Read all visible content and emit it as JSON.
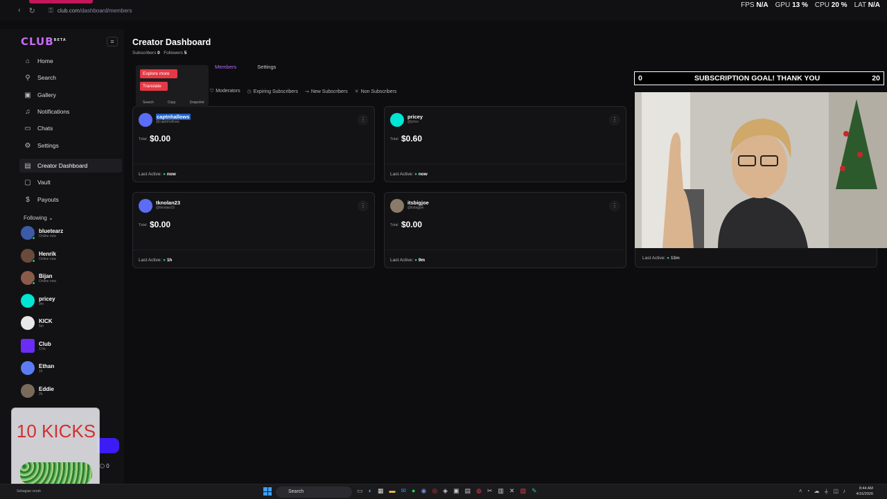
{
  "browser": {
    "url_host": "club.com",
    "url_path": "/dashboard/members"
  },
  "stats": {
    "fps_label": "FPS",
    "fps": "N/A",
    "gpu_label": "GPU",
    "gpu": "13 %",
    "cpu_label": "CPU",
    "cpu": "20 %",
    "lat_label": "LAT",
    "lat": "N/A"
  },
  "sidebar": {
    "logo": "CLUB",
    "logo_badge": "BETA",
    "items": [
      {
        "label": "Home",
        "icon": "home-icon"
      },
      {
        "label": "Search",
        "icon": "search-icon"
      },
      {
        "label": "Gallery",
        "icon": "gallery-icon"
      },
      {
        "label": "Notifications",
        "icon": "bell-icon"
      },
      {
        "label": "Chats",
        "icon": "chat-icon"
      },
      {
        "label": "Settings",
        "icon": "gear-icon"
      },
      {
        "label": "Creator Dashboard",
        "icon": "dashboard-icon",
        "active": true
      },
      {
        "label": "Vault",
        "icon": "vault-icon"
      },
      {
        "label": "Payouts",
        "icon": "dollar-icon"
      }
    ],
    "following_header": "Following",
    "following": [
      {
        "name": "bluetearz",
        "status": "Online now",
        "color": "#3b5ba8"
      },
      {
        "name": "Henrik",
        "status": "Online now",
        "color": "#6a4a3a"
      },
      {
        "name": "Bijan",
        "status": "Online now",
        "color": "#8a5a4a"
      },
      {
        "name": "pricey",
        "status": "9m",
        "color": "#00e5d4"
      },
      {
        "name": "KICK",
        "status": "5m",
        "color": "#e8e8e8"
      },
      {
        "name": "Club",
        "status": "17m",
        "color": "#6b2cf5"
      },
      {
        "name": "Ethan",
        "status": "1h",
        "color": "#5b7cf5"
      },
      {
        "name": "Eddie",
        "status": "2h",
        "color": "#7a6a5a"
      }
    ]
  },
  "overlay": {
    "kicks": "10 KICKS",
    "badge": "0"
  },
  "main": {
    "title": "Creator Dashboard",
    "subscribers_label": "Subscribers",
    "subscribers": "0",
    "followers_label": "Followers",
    "followers": "5",
    "tabs": [
      {
        "label": "Members",
        "active": true
      },
      {
        "label": "Settings"
      }
    ],
    "filters": [
      "Moderators",
      "Expiring Subscribers",
      "New Subscribers",
      "Non Subscribers"
    ],
    "context_menu": {
      "explore": "Explore more",
      "translate": "Translate",
      "search": "Search",
      "copy": "Copy",
      "snapshot": "Snapshot"
    },
    "members": [
      {
        "name": "captnhallows",
        "handle": "@captnhallows",
        "total_label": "Total",
        "total": "$0.00",
        "last_active_label": "Last Active:",
        "last_active": "now",
        "color": "#5b6cf5"
      },
      {
        "name": "pricey",
        "handle": "@price",
        "total_label": "Total",
        "total": "$0.60",
        "last_active_label": "Last Active:",
        "last_active": "now",
        "color": "#00e5d4"
      },
      {
        "name": "tknolan23",
        "handle": "@tknolan23",
        "total_label": "Total",
        "total": "$0.00",
        "last_active_label": "Last Active:",
        "last_active": "1h",
        "color": "#5b6cf5"
      },
      {
        "name": "itsbigjoe",
        "handle": "@itsbigjoe",
        "total_label": "Total",
        "total": "$0.00",
        "last_active_label": "Last Active:",
        "last_active": "9m",
        "color": "#8a7a6a"
      }
    ],
    "card5": {
      "last_active_label": "Last Active:",
      "last_active": "13m"
    }
  },
  "goal": {
    "left": "0",
    "text": "SUBSCRIPTION GOAL! THANK YOU",
    "right": "20"
  },
  "taskbar": {
    "search": "Search",
    "time": "8:44 AM",
    "date": "4/16/2026",
    "notice": "Sebagian cerah"
  }
}
